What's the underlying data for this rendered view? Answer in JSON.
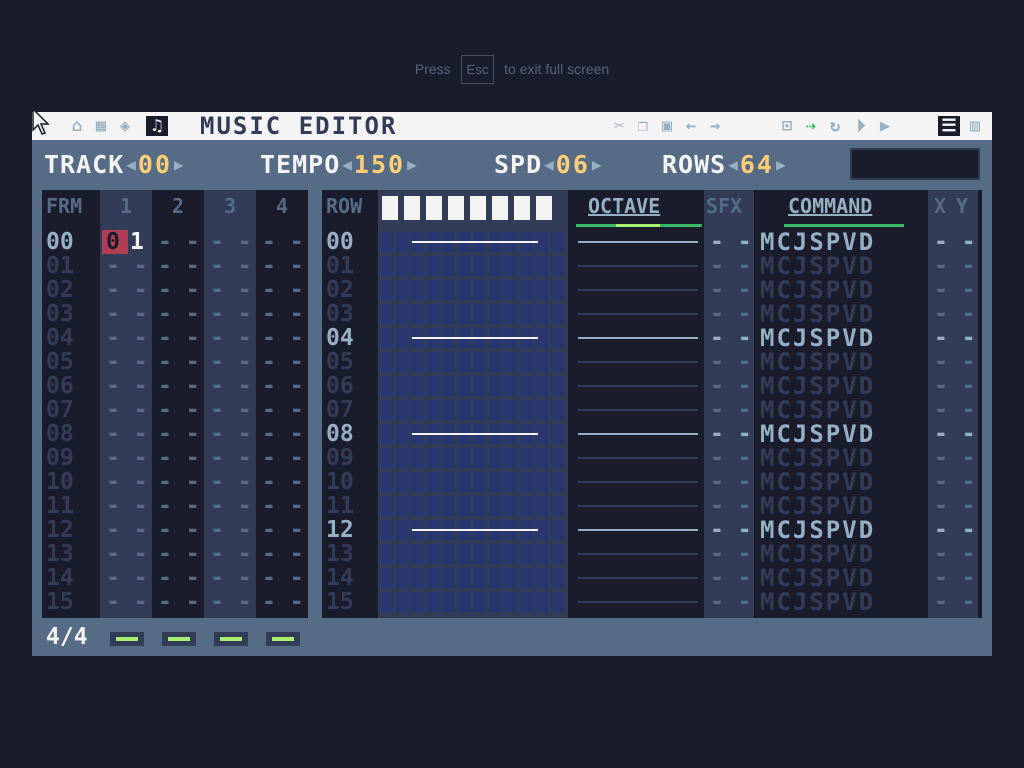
{
  "hint": {
    "pre": "Press",
    "key": "Esc",
    "post": "to exit full screen"
  },
  "titlebar": {
    "title": "MUSIC EDITOR",
    "left_icons": [
      "home-icon",
      "hud-icon",
      "map-icon",
      "sound-icon",
      "music-note-icon"
    ],
    "right_icons": [
      "cut-icon",
      "copy-icon",
      "paste-icon",
      "undo-icon",
      "redo-icon",
      "loop-icon",
      "follow-icon",
      "repeat-icon",
      "play-pattern-icon",
      "play-icon",
      "tracker-view-icon",
      "piano-view-icon"
    ]
  },
  "header": {
    "track_label": "TRACK",
    "track_value": "00",
    "tempo_label": "TEMPO",
    "tempo_value": "150",
    "spd_label": "SPD",
    "spd_value": "06",
    "rows_label": "ROWS",
    "rows_value": "64"
  },
  "frames": {
    "headers": [
      "FRM",
      "1",
      "2",
      "3",
      "4"
    ],
    "rows": [
      "00",
      "01",
      "02",
      "03",
      "04",
      "05",
      "06",
      "07",
      "08",
      "09",
      "10",
      "11",
      "12",
      "13",
      "14",
      "15"
    ],
    "first_pattern_channel1": "1",
    "cursor_value": "0",
    "empty": "--"
  },
  "pattern": {
    "headers": {
      "row": "ROW",
      "octave": "OCTAVE",
      "sfx": "SFX",
      "command": "COMMAND",
      "x": "X",
      "y": "Y"
    },
    "rows": [
      "00",
      "01",
      "02",
      "03",
      "04",
      "05",
      "06",
      "07",
      "08",
      "09",
      "10",
      "11",
      "12",
      "13",
      "14",
      "15"
    ],
    "command_letters": "MCJSPVD",
    "empty": "--"
  },
  "footer": {
    "signature": "4/4",
    "pattern_buttons": 4
  },
  "colors": {
    "bg": "#1a1c2c",
    "panel": "#566c86",
    "accent": "#ffcd75",
    "cursor": "#b13e53",
    "green": "#a7f070"
  }
}
